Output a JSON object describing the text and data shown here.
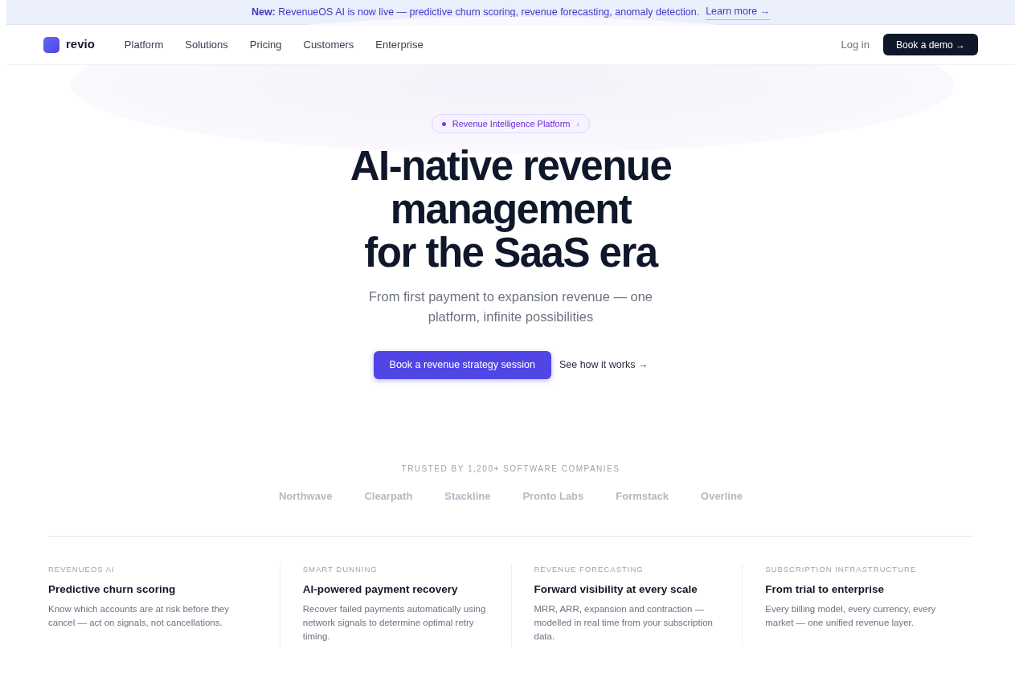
{
  "announcement": {
    "text": "**New:** RevenueOS AI is now live — predictive churn scoring, revenue forecasting, anomaly detection.",
    "link": "Learn more →"
  },
  "nav": {
    "brand": "revio",
    "links": [
      "Platform",
      "Solutions",
      "Pricing",
      "Customers",
      "Enterprise"
    ],
    "login": "Log in",
    "cta": "Book a demo →"
  },
  "hero": {
    "pill": "Revenue Intelligence Platform",
    "pill_chevron": "›",
    "title_lines": [
      "AI-native revenue",
      "management",
      "for the SaaS era"
    ],
    "subtitle": "From first payment to expansion revenue — one platform, infinite possibilities",
    "primary_button": "Book a revenue strategy session",
    "secondary_link": "See how it works →"
  },
  "trusted": {
    "heading": "TRUSTED BY 1,200+ SOFTWARE COMPANIES",
    "logos": [
      "Northwave",
      "Clearpath",
      "Stackline",
      "Pronto Labs",
      "Formstack",
      "Overline"
    ]
  },
  "features": [
    {
      "eyebrow": "REVENUEOS AI",
      "title": "Predictive churn scoring",
      "text": "Know which accounts are at risk before they cancel — act on signals, not cancellations."
    },
    {
      "eyebrow": "SMART DUNNING",
      "title": "AI-powered payment recovery",
      "text": "Recover failed payments automatically using network signals to determine optimal retry timing."
    },
    {
      "eyebrow": "REVENUE FORECASTING",
      "title": "Forward visibility at every scale",
      "text": "MRR, ARR, expansion and contraction — modelled in real time from your subscription data."
    },
    {
      "eyebrow": "SUBSCRIPTION INFRASTRUCTURE",
      "title": "From trial to enterprise",
      "text": "Every billing model, every currency, every market — one unified revenue layer."
    }
  ]
}
